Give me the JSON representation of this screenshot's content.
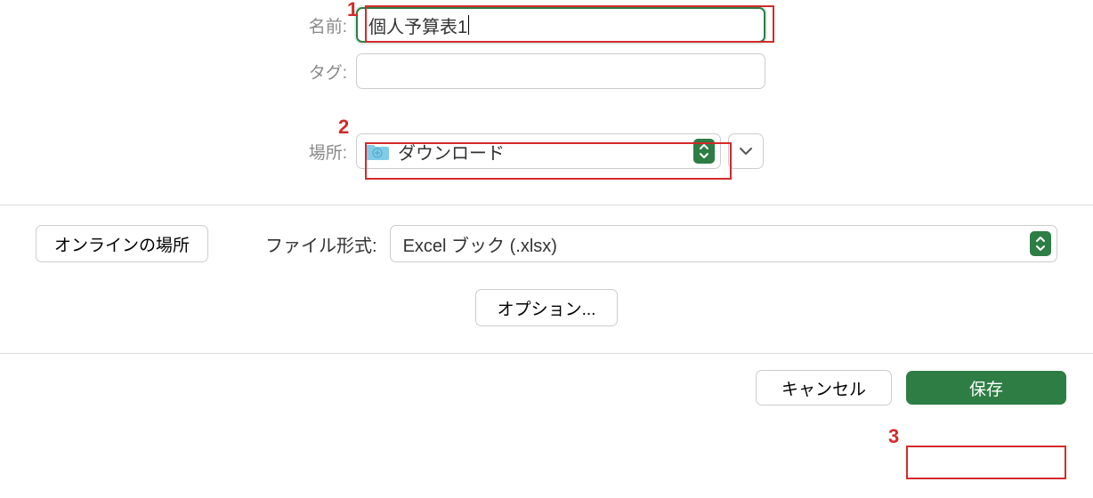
{
  "form": {
    "name_label": "名前:",
    "name_value": "個人予算表1",
    "tag_label": "タグ:",
    "tag_value": "",
    "location_label": "場所:",
    "location_value": "ダウンロード"
  },
  "file_format": {
    "online_button": "オンラインの場所",
    "label": "ファイル形式:",
    "value": "Excel ブック (.xlsx)",
    "options_button": "オプション..."
  },
  "actions": {
    "cancel": "キャンセル",
    "save": "保存"
  },
  "annotations": {
    "n1": "1",
    "n2": "2",
    "n3": "3"
  }
}
